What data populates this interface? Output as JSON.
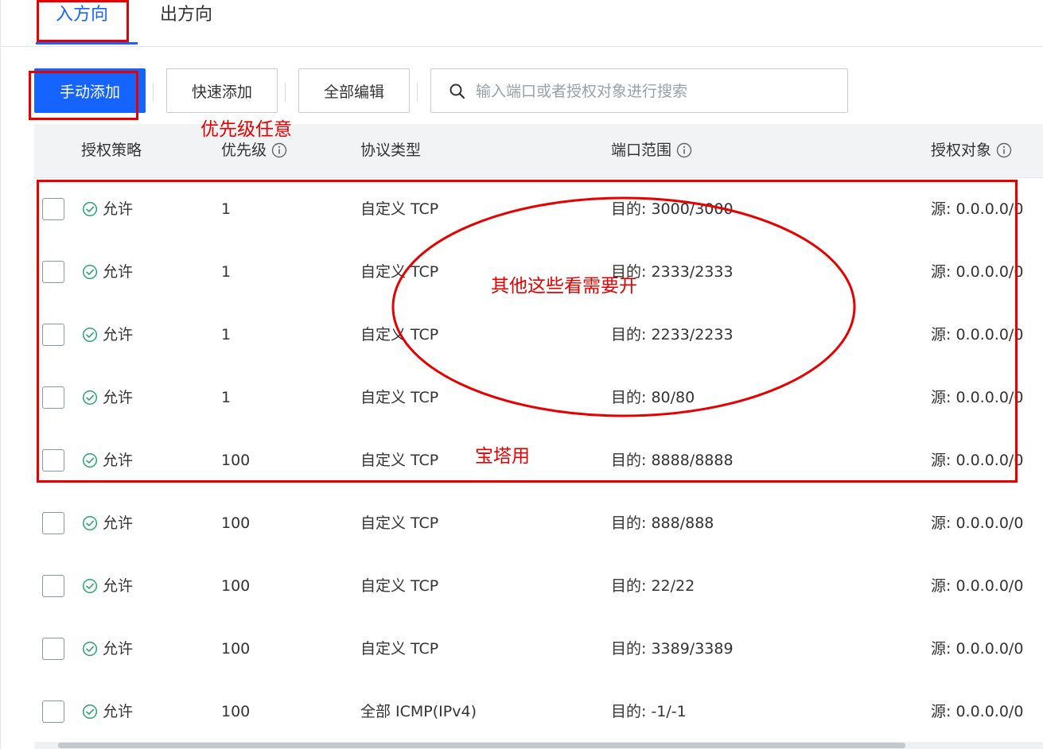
{
  "tabs": {
    "inbound": "入方向",
    "outbound": "出方向"
  },
  "toolbar": {
    "manual_add": "手动添加",
    "quick_add": "快速添加",
    "edit_all": "全部编辑",
    "search_placeholder": "输入端口或者授权对象进行搜索"
  },
  "table": {
    "headers": {
      "policy": "授权策略",
      "priority": "优先级",
      "protocol": "协议类型",
      "port_range": "端口范围",
      "auth_object": "授权对象"
    },
    "rows": [
      {
        "policy": "允许",
        "priority": "1",
        "protocol": "自定义 TCP",
        "port": "目的: 3000/3000",
        "source": "源: 0.0.0.0/0"
      },
      {
        "policy": "允许",
        "priority": "1",
        "protocol": "自定义 TCP",
        "port": "目的: 2333/2333",
        "source": "源: 0.0.0.0/0"
      },
      {
        "policy": "允许",
        "priority": "1",
        "protocol": "自定义 TCP",
        "port": "目的: 2233/2233",
        "source": "源: 0.0.0.0/0"
      },
      {
        "policy": "允许",
        "priority": "1",
        "protocol": "自定义 TCP",
        "port": "目的: 80/80",
        "source": "源: 0.0.0.0/0"
      },
      {
        "policy": "允许",
        "priority": "100",
        "protocol": "自定义 TCP",
        "port": "目的: 8888/8888",
        "source": "源: 0.0.0.0/0"
      },
      {
        "policy": "允许",
        "priority": "100",
        "protocol": "自定义 TCP",
        "port": "目的: 888/888",
        "source": "源: 0.0.0.0/0"
      },
      {
        "policy": "允许",
        "priority": "100",
        "protocol": "自定义 TCP",
        "port": "目的: 22/22",
        "source": "源: 0.0.0.0/0"
      },
      {
        "policy": "允许",
        "priority": "100",
        "protocol": "自定义 TCP",
        "port": "目的: 3389/3389",
        "source": "源: 0.0.0.0/0"
      },
      {
        "policy": "允许",
        "priority": "100",
        "protocol": "全部 ICMP(IPv4)",
        "port": "目的: -1/-1",
        "source": "源: 0.0.0.0/0"
      }
    ]
  },
  "annotations": {
    "priority_note": "优先级任意",
    "others_note": "其他这些看需要开",
    "baota_note": "宝塔用"
  },
  "colors": {
    "accent": "#1664ff",
    "allow": "#2ba471",
    "annotation": "#e60000"
  }
}
